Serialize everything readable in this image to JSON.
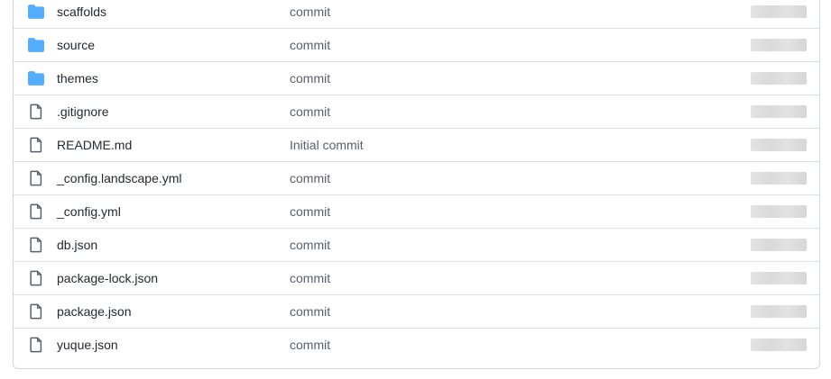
{
  "files": [
    {
      "name": "scaffolds",
      "type": "folder",
      "icon": "folder-icon",
      "commit_message": "commit",
      "age": ""
    },
    {
      "name": "source",
      "type": "folder",
      "icon": "folder-icon",
      "commit_message": "commit",
      "age": ""
    },
    {
      "name": "themes",
      "type": "folder",
      "icon": "folder-icon",
      "commit_message": "commit",
      "age": ""
    },
    {
      "name": ".gitignore",
      "type": "file",
      "icon": "file-icon",
      "commit_message": "commit",
      "age": ""
    },
    {
      "name": "README.md",
      "type": "file",
      "icon": "file-icon",
      "commit_message": "Initial commit",
      "age": ""
    },
    {
      "name": "_config.landscape.yml",
      "type": "file",
      "icon": "file-icon",
      "commit_message": "commit",
      "age": ""
    },
    {
      "name": "_config.yml",
      "type": "file",
      "icon": "file-icon",
      "commit_message": "commit",
      "age": ""
    },
    {
      "name": "db.json",
      "type": "file",
      "icon": "file-icon",
      "commit_message": "commit",
      "age": ""
    },
    {
      "name": "package-lock.json",
      "type": "file",
      "icon": "file-icon",
      "commit_message": "commit",
      "age": ""
    },
    {
      "name": "package.json",
      "type": "file",
      "icon": "file-icon",
      "commit_message": "commit",
      "age": ""
    },
    {
      "name": "yuque.json",
      "type": "file",
      "icon": "file-icon",
      "commit_message": "commit",
      "age": ""
    }
  ],
  "colors": {
    "folder": "#54aeff",
    "file_icon": "#57606a",
    "border": "#d0d7de"
  }
}
